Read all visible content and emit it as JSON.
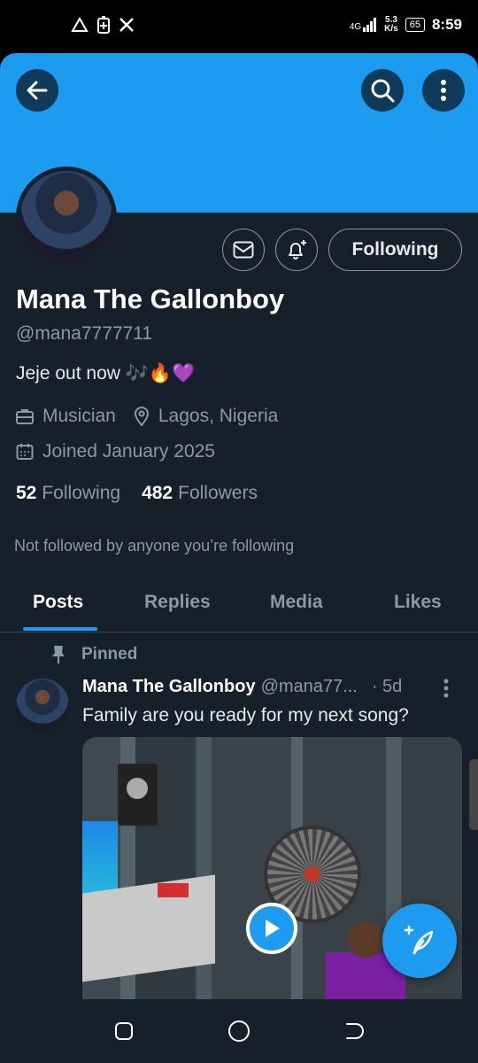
{
  "status_bar": {
    "network": "4G",
    "speed_value": "5.3",
    "speed_unit": "K/s",
    "battery": "65",
    "time": "8:59"
  },
  "profile": {
    "name": "Mana The Gallonboy",
    "handle": "@mana7777711",
    "bio": "Jeje out now 🎶🔥💜",
    "occupation": "Musician",
    "location": "Lagos, Nigeria",
    "joined": "Joined January 2025",
    "following_count": "52",
    "following_label": "Following",
    "followers_count": "482",
    "followers_label": "Followers",
    "not_followed_text": "Not followed by anyone you’re following",
    "follow_button_label": "Following"
  },
  "tabs": [
    {
      "label": "Posts",
      "active": true
    },
    {
      "label": "Replies",
      "active": false
    },
    {
      "label": "Media",
      "active": false
    },
    {
      "label": "Likes",
      "active": false
    }
  ],
  "post": {
    "pinned_label": "Pinned",
    "author_name": "Mana The Gallonboy",
    "author_handle": "@mana77...",
    "time": "· 5d",
    "text": "Family are you ready for my next song?"
  },
  "icons": {
    "back": "arrow-left-icon",
    "search": "search-icon",
    "more": "more-vertical-icon",
    "message": "envelope-icon",
    "notify": "bell-plus-icon",
    "occupation": "briefcase-icon",
    "location": "map-pin-icon",
    "joined": "calendar-icon",
    "pin": "pin-icon",
    "play": "play-icon",
    "compose": "compose-feather-icon"
  },
  "colors": {
    "accent": "#1d9bf0",
    "background": "#15202b",
    "text_secondary": "#8b98a5"
  }
}
